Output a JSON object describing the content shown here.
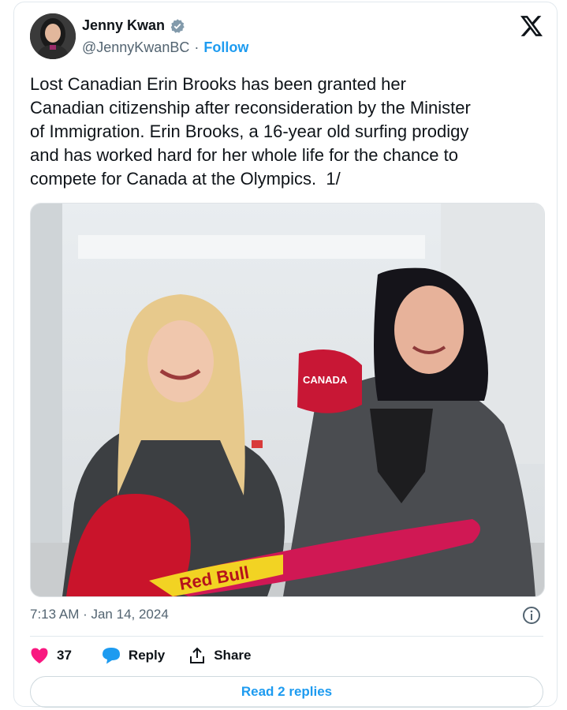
{
  "author": {
    "name": "Jenny Kwan",
    "handle": "@JennyKwanBC",
    "separator": "·",
    "follow_label": "Follow"
  },
  "tweet": {
    "text": "Lost Canadian Erin Brooks has been granted her\nCanadian citizenship after reconsideration by the Minister\nof Immigration. Erin Brooks, a 16-year old surfing prodigy\nand has worked hard for her whole life for the chance to\ncompete for Canada at the Olympics.  1/",
    "timestamp": "7:13 AM · Jan 14, 2024",
    "photo": {
      "cap_text": "CANADA",
      "board_text": "Red Bull"
    }
  },
  "actions": {
    "like_count": "37",
    "reply_label": "Reply",
    "share_label": "Share"
  },
  "read_replies_label": "Read 2 replies",
  "colors": {
    "accent": "#1d9bf0",
    "like": "#f91880",
    "text": "#0f1419",
    "secondary": "#536471"
  },
  "icons": [
    "verified-badge-icon",
    "x-logo-icon",
    "info-icon",
    "heart-icon",
    "reply-icon",
    "share-icon"
  ]
}
